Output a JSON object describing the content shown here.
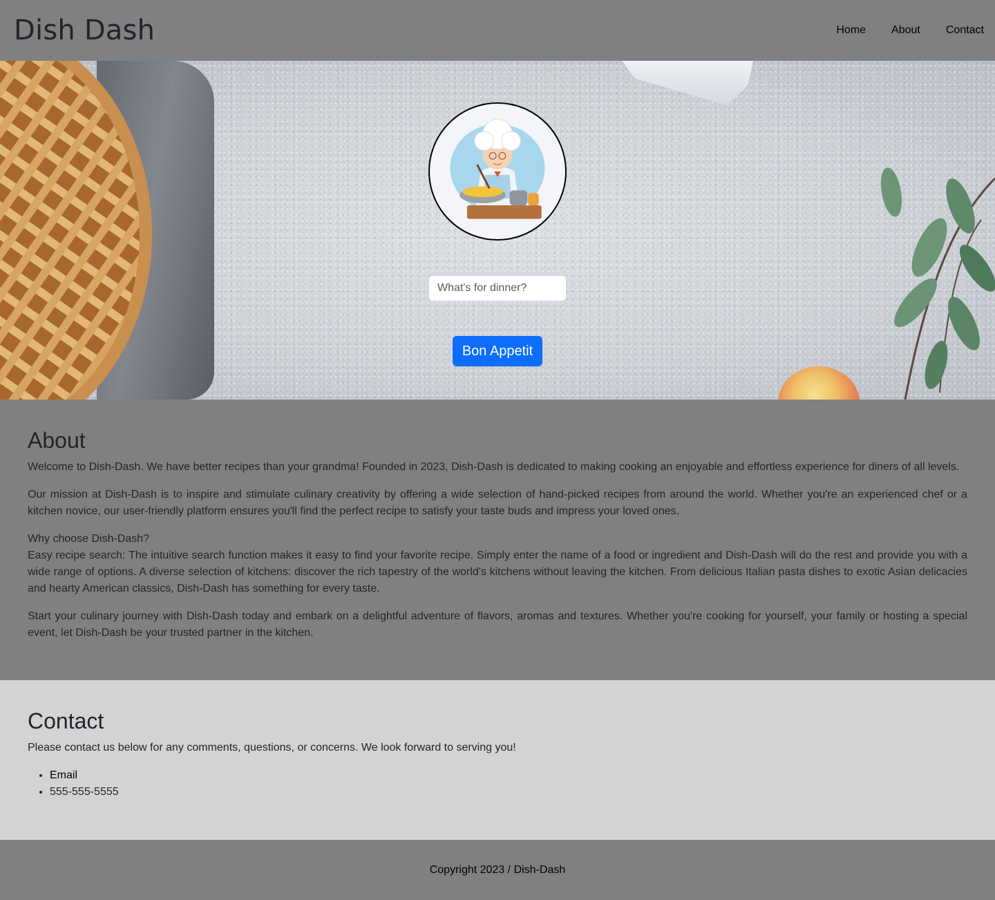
{
  "header": {
    "brand": "Dish Dash",
    "nav": [
      {
        "label": "Home"
      },
      {
        "label": "About"
      },
      {
        "label": "Contact"
      }
    ]
  },
  "hero": {
    "search_placeholder": "What's for dinner?",
    "search_value": "",
    "cta_label": "Bon Appetit"
  },
  "about": {
    "title": "About",
    "paragraphs": [
      "Welcome to Dish-Dash. We have better recipes than your grandma! Founded in 2023, Dish-Dash is dedicated to making cooking an enjoyable and effortless experience for diners of all levels.",
      "Our mission at Dish-Dash is to inspire and stimulate culinary creativity by offering a wide selection of hand-picked recipes from around the world. Whether you're an experienced chef or a kitchen novice, our user-friendly platform ensures you'll find the perfect recipe to satisfy your taste buds and impress your loved ones.",
      "Why choose Dish-Dash?",
      "Easy recipe search: The intuitive search function makes it easy to find your favorite recipe. Simply enter the name of a food or ingredient and Dish-Dash will do the rest and provide you with a wide range of options. A diverse selection of kitchens: discover the rich tapestry of the world's kitchens without leaving the kitchen. From delicious Italian pasta dishes to exotic Asian delicacies and hearty American classics, Dish-Dash has something for every taste.",
      "Start your culinary journey with Dish-Dash today and embark on a delightful adventure of flavors, aromas and textures. Whether you're cooking for yourself, your family or hosting a special event, let Dish-Dash be your trusted partner in the kitchen."
    ]
  },
  "contact": {
    "title": "Contact",
    "intro": "Please contact us below for any comments, questions, or concerns. We look forward to serving you!",
    "items": [
      {
        "label": "Email"
      },
      {
        "label": "555-555-5555"
      }
    ]
  },
  "footer": {
    "copyright": "Copyright 2023 / Dish-Dash"
  },
  "colors": {
    "header_bg": "#808080",
    "contact_bg": "#d3d3d3",
    "button_primary": "#0d6efd"
  },
  "icons": {
    "avatar": "grandma-chef-illustration"
  }
}
